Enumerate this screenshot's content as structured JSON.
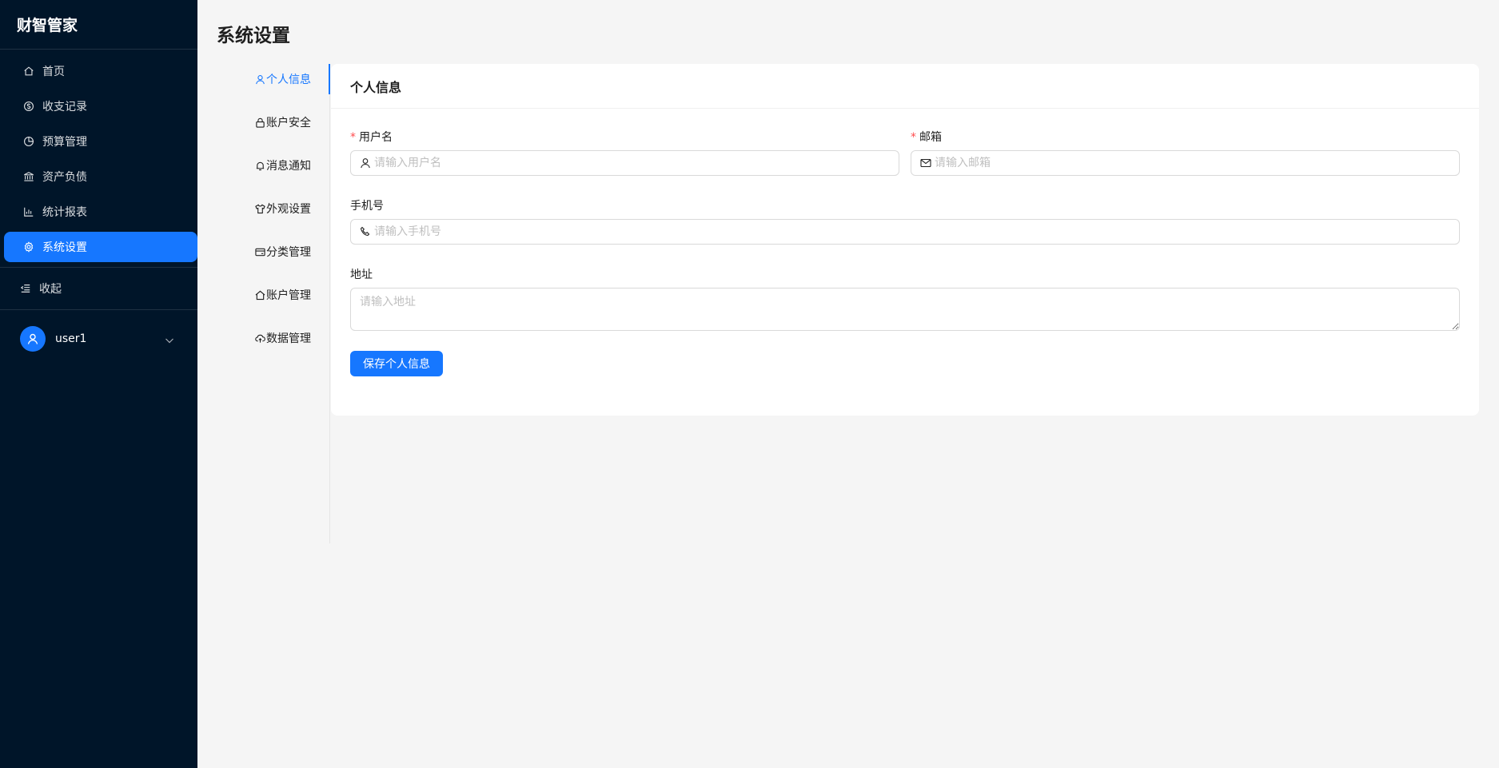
{
  "brand": "财智管家",
  "sidebar": {
    "items": [
      {
        "label": "首页",
        "icon": "home-icon"
      },
      {
        "label": "收支记录",
        "icon": "dollar-icon"
      },
      {
        "label": "预算管理",
        "icon": "pie-chart-icon"
      },
      {
        "label": "资产负债",
        "icon": "bank-icon"
      },
      {
        "label": "统计报表",
        "icon": "bar-chart-icon"
      },
      {
        "label": "系统设置",
        "icon": "gear-icon",
        "active": true
      }
    ],
    "collapse_label": "收起",
    "user_name": "user1"
  },
  "page": {
    "title": "系统设置"
  },
  "tabs": [
    {
      "label": "个人信息",
      "icon": "user-icon",
      "active": true
    },
    {
      "label": "账户安全",
      "icon": "lock-icon"
    },
    {
      "label": "消息通知",
      "icon": "bell-icon"
    },
    {
      "label": "外观设置",
      "icon": "skin-icon"
    },
    {
      "label": "分类管理",
      "icon": "credit-card-icon"
    },
    {
      "label": "账户管理",
      "icon": "home-icon"
    },
    {
      "label": "数据管理",
      "icon": "cloud-upload-icon"
    }
  ],
  "form": {
    "card_title": "个人信息",
    "username": {
      "label": "用户名",
      "required_mark": "*",
      "placeholder": "请输入用户名",
      "value": ""
    },
    "email": {
      "label": "邮箱",
      "required_mark": "*",
      "placeholder": "请输入邮箱",
      "value": ""
    },
    "phone": {
      "label": "手机号",
      "placeholder": "请输入手机号",
      "value": ""
    },
    "address": {
      "label": "地址",
      "placeholder": "请输入地址",
      "value": ""
    },
    "save_label": "保存个人信息"
  },
  "colors": {
    "sidebar_bg": "#001529",
    "accent": "#1677ff",
    "required": "#ff4d4f"
  }
}
